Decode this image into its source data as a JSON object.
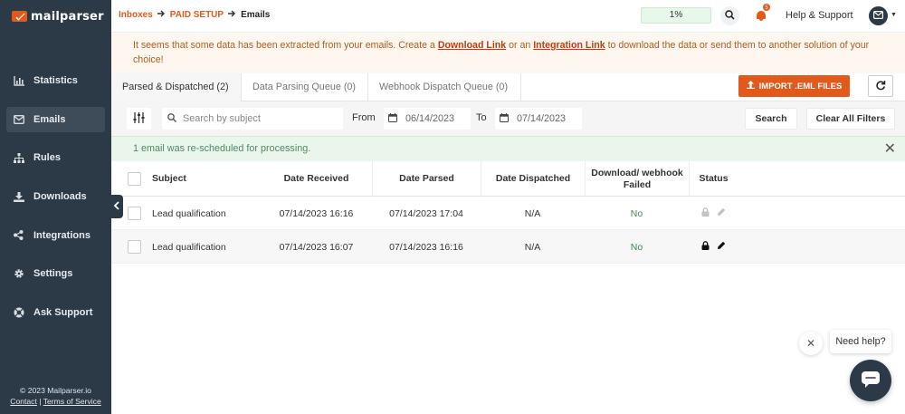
{
  "app": {
    "logo_text": "mailparser",
    "brand_color": "#e25a1b",
    "sidebar_color": "#2c3a48"
  },
  "sidebar": {
    "items": [
      {
        "label": "Statistics",
        "icon": "bar-chart-icon"
      },
      {
        "label": "Emails",
        "icon": "envelope-icon",
        "active": true
      },
      {
        "label": "Rules",
        "icon": "sitemap-icon"
      },
      {
        "label": "Downloads",
        "icon": "download-icon"
      },
      {
        "label": "Integrations",
        "icon": "share-icon"
      },
      {
        "label": "Settings",
        "icon": "gear-icon"
      },
      {
        "label": "Ask Support",
        "icon": "lifebuoy-icon"
      }
    ],
    "footer": {
      "copyright": "© 2023 Mailparser.io",
      "contact": "Contact",
      "terms": "Terms of Service"
    }
  },
  "header": {
    "breadcrumb": [
      "Inboxes",
      "PAID SETUP",
      "Emails"
    ],
    "progress": "1%",
    "notification_count": "5",
    "help": "Help & Support"
  },
  "notice": {
    "text_before": "It seems that some data has been extracted from your emails. Create a ",
    "link1": "Download Link",
    "text_middle": " or an ",
    "link2": "Integration Link",
    "text_after": " to download the data or send them to another solution of your choice!"
  },
  "tabs": [
    {
      "label": "Parsed & Dispatched (2)",
      "active": true
    },
    {
      "label": "Data Parsing Queue (0)"
    },
    {
      "label": "Webhook Dispatch Queue (0)"
    }
  ],
  "actions": {
    "import_label": "IMPORT .EML FILES"
  },
  "filters": {
    "search_placeholder": "Search by subject",
    "from_label": "From",
    "from_date": "06/14/2023",
    "to_label": "To",
    "to_date": "07/14/2023",
    "search_button": "Search",
    "clear_button": "Clear All Filters"
  },
  "alert": {
    "message": "1 email was re-scheduled for processing."
  },
  "table": {
    "columns": [
      "Subject",
      "Date Received",
      "Date Parsed",
      "Date Dispatched",
      "Download/ webhook Failed",
      "Status"
    ],
    "rows": [
      {
        "subject": "Lead qualification",
        "received": "07/14/2023 16:16",
        "parsed": "07/14/2023 17:04",
        "dispatched": "N/A",
        "failed": "No"
      },
      {
        "subject": "Lead qualification",
        "received": "07/14/2023 16:07",
        "parsed": "07/14/2023 16:16",
        "dispatched": "N/A",
        "failed": "No"
      }
    ]
  },
  "chat": {
    "bubble": "Need help?"
  }
}
